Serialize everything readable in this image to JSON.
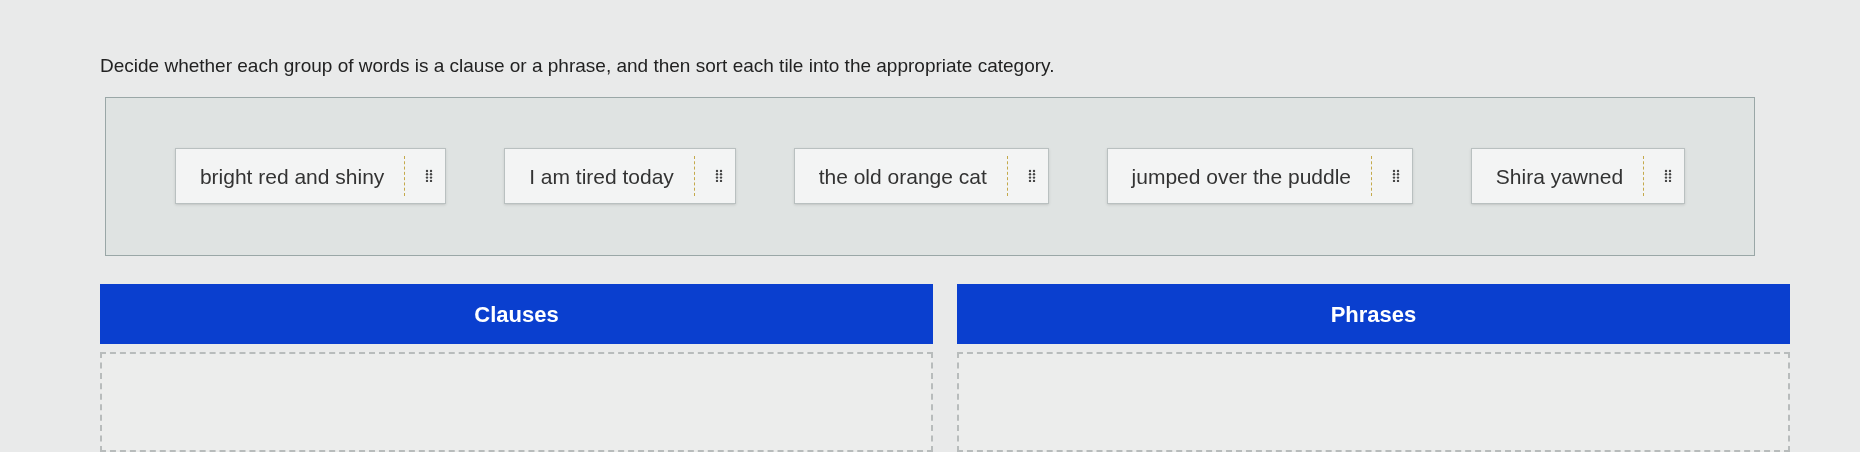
{
  "instructions": "Decide whether each group of words is a clause or a phrase, and then sort each tile into the appropriate category.",
  "tiles": [
    {
      "label": "bright red and shiny"
    },
    {
      "label": "I am tired today"
    },
    {
      "label": "the old orange cat"
    },
    {
      "label": "jumped over the puddle"
    },
    {
      "label": "Shira yawned"
    }
  ],
  "categories": [
    {
      "title": "Clauses"
    },
    {
      "title": "Phrases"
    }
  ]
}
